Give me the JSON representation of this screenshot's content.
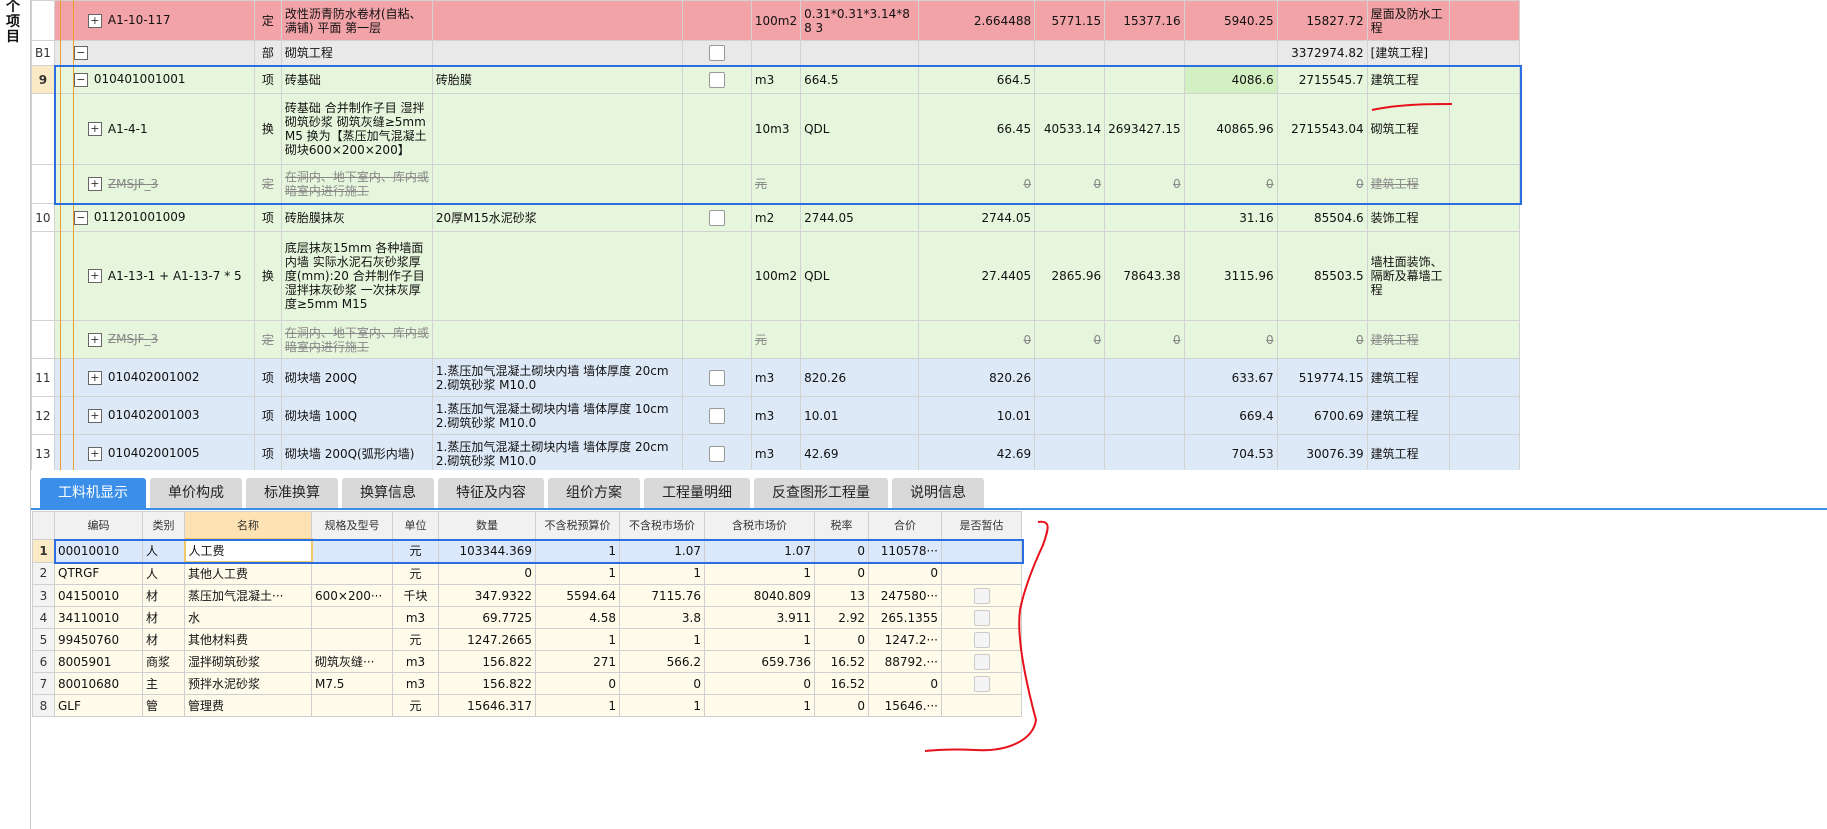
{
  "side_label": [
    "个",
    "项",
    "目"
  ],
  "upper_rows": [
    {
      "style": "red",
      "rowno": "",
      "tree": "+",
      "code": "A1-10-117",
      "type": "定",
      "name": "改性沥青防水卷材(自粘、满铺) 平面 第一层",
      "feature": "",
      "check": false,
      "unit": "100m2",
      "expr": "0.31*0.31*3.14*88 3",
      "qty": "2.664488",
      "c1": "5771.15",
      "c2": "15377.16",
      "price": "5940.25",
      "total": "15827.72",
      "major": "屋面及防水工程"
    },
    {
      "style": "gray",
      "rowno": "B1",
      "tree": "−",
      "code": "",
      "type": "部",
      "name": "砌筑工程",
      "feature": "",
      "check": true,
      "unit": "",
      "expr": "",
      "qty": "",
      "c1": "",
      "c2": "",
      "price": "",
      "total": "3372974.82",
      "major": "[建筑工程]"
    },
    {
      "style": "green",
      "rowno": "9",
      "tree": "−",
      "code": "010401001001",
      "type": "项",
      "name": "砖基础",
      "feature": "砖胎膜",
      "check": true,
      "unit": "m3",
      "expr": "664.5",
      "qty": "664.5",
      "c1": "",
      "c2": "",
      "price": "4086.6",
      "total": "2715545.7",
      "major": "建筑工程"
    },
    {
      "style": "green",
      "rowno": "",
      "tree": "+",
      "code": "A1-4-1",
      "type": "换",
      "name": "砖基础 合并制作子目 湿拌砌筑砂浆 砌筑灰缝≥5mm M5 换为【蒸压加气混凝土砌块600×200×200】",
      "feature": "",
      "check": false,
      "unit": "10m3",
      "expr": "QDL",
      "qty": "66.45",
      "c1": "40533.14",
      "c2": "2693427.15",
      "price": "40865.96",
      "total": "2715543.04",
      "major": "砌筑工程"
    },
    {
      "style": "green strike",
      "rowno": "",
      "tree": "+",
      "code": "ZMSJF_3",
      "type": "定",
      "name": "在洞内、地下室内、库内或暗室内进行施工",
      "feature": "",
      "check": false,
      "unit": "元",
      "expr": "",
      "qty": "0",
      "c1": "0",
      "c2": "0",
      "price": "0",
      "total": "0",
      "major": "建筑工程"
    },
    {
      "style": "green",
      "rowno": "10",
      "tree": "−",
      "code": "011201001009",
      "type": "项",
      "name": "砖胎膜抹灰",
      "feature": "20厚M15水泥砂浆",
      "check": true,
      "unit": "m2",
      "expr": "2744.05",
      "qty": "2744.05",
      "c1": "",
      "c2": "",
      "price": "31.16",
      "total": "85504.6",
      "major": "装饰工程"
    },
    {
      "style": "green",
      "rowno": "",
      "tree": "+",
      "code": "A1-13-1 + A1-13-7 * 5",
      "type": "换",
      "name": "底层抹灰15mm 各种墙面 内墙 实际水泥石灰砂浆厚度(mm):20 合并制作子目 湿拌抹灰砂浆 一次抹灰厚度≥5mm M15",
      "feature": "",
      "check": false,
      "unit": "100m2",
      "expr": "QDL",
      "qty": "27.4405",
      "c1": "2865.96",
      "c2": "78643.38",
      "price": "3115.96",
      "total": "85503.5",
      "major": "墙柱面装饰、隔断及幕墙工程"
    },
    {
      "style": "green strike",
      "rowno": "",
      "tree": "+",
      "code": "ZMSJF_3",
      "type": "定",
      "name": "在洞内、地下室内、库内或暗室内进行施工",
      "feature": "",
      "check": false,
      "unit": "元",
      "expr": "",
      "qty": "0",
      "c1": "0",
      "c2": "0",
      "price": "0",
      "total": "0",
      "major": "建筑工程"
    },
    {
      "style": "blue",
      "rowno": "11",
      "tree": "+",
      "code": "010402001002",
      "type": "项",
      "name": "砌块墙 200Q",
      "feature": "1.蒸压加气混凝土砌块内墙 墙体厚度 20cm 2.砌筑砂浆 M10.0",
      "check": true,
      "unit": "m3",
      "expr": "820.26",
      "qty": "820.26",
      "c1": "",
      "c2": "",
      "price": "633.67",
      "total": "519774.15",
      "major": "建筑工程"
    },
    {
      "style": "blue",
      "rowno": "12",
      "tree": "+",
      "code": "010402001003",
      "type": "项",
      "name": "砌块墙 100Q",
      "feature": "1.蒸压加气混凝土砌块内墙 墙体厚度 10cm 2.砌筑砂浆 M10.0",
      "check": true,
      "unit": "m3",
      "expr": "10.01",
      "qty": "10.01",
      "c1": "",
      "c2": "",
      "price": "669.4",
      "total": "6700.69",
      "major": "建筑工程"
    },
    {
      "style": "blue",
      "rowno": "13",
      "tree": "+",
      "code": "010402001005",
      "type": "项",
      "name": "砌块墙 200Q(弧形内墙)",
      "feature": "1.蒸压加气混凝土砌块内墙 墙体厚度 20cm 2.砌筑砂浆 M10.0",
      "check": true,
      "unit": "m3",
      "expr": "42.69",
      "qty": "42.69",
      "c1": "",
      "c2": "",
      "price": "704.53",
      "total": "30076.39",
      "major": "建筑工程"
    }
  ],
  "tabs": [
    "工料机显示",
    "单价构成",
    "标准换算",
    "换算信息",
    "特征及内容",
    "组价方案",
    "工程量明细",
    "反查图形工程量",
    "说明信息"
  ],
  "lower_headers": [
    "编码",
    "类别",
    "名称",
    "规格及型号",
    "单位",
    "数量",
    "不含税预算价",
    "不含税市场价",
    "含税市场价",
    "税率",
    "合价",
    "是否暂估"
  ],
  "lower_rows": [
    {
      "no": "1",
      "code": "00010010",
      "cat": "人",
      "name": "人工费",
      "spec": "",
      "unit": "元",
      "qty": "103344.369",
      "p1": "1",
      "p2": "1.07",
      "p3": "1.07",
      "tax": "0",
      "total": "110578···",
      "chk": false
    },
    {
      "no": "2",
      "code": "QTRGF",
      "cat": "人",
      "name": "其他人工费",
      "spec": "",
      "unit": "元",
      "qty": "0",
      "p1": "1",
      "p2": "1",
      "p3": "1",
      "tax": "0",
      "total": "0",
      "chk": false
    },
    {
      "no": "3",
      "code": "04150010",
      "cat": "材",
      "name": "蒸压加气混凝土···",
      "spec": "600×200···",
      "unit": "千块",
      "qty": "347.9322",
      "p1": "5594.64",
      "p2": "7115.76",
      "p3": "8040.809",
      "tax": "13",
      "total": "247580···",
      "chk": true
    },
    {
      "no": "4",
      "code": "34110010",
      "cat": "材",
      "name": "水",
      "spec": "",
      "unit": "m3",
      "qty": "69.7725",
      "p1": "4.58",
      "p2": "3.8",
      "p3": "3.911",
      "tax": "2.92",
      "total": "265.1355",
      "chk": true
    },
    {
      "no": "5",
      "code": "99450760",
      "cat": "材",
      "name": "其他材料费",
      "spec": "",
      "unit": "元",
      "qty": "1247.2665",
      "p1": "1",
      "p2": "1",
      "p3": "1",
      "tax": "0",
      "total": "1247.2···",
      "chk": true
    },
    {
      "no": "6",
      "code": "8005901",
      "cat": "商浆",
      "name": "湿拌砌筑砂浆",
      "spec": "砌筑灰缝···",
      "unit": "m3",
      "qty": "156.822",
      "p1": "271",
      "p2": "566.2",
      "p3": "659.736",
      "tax": "16.52",
      "total": "88792.···",
      "chk": true
    },
    {
      "no": "7",
      "code": "80010680",
      "cat": "主",
      "name": "预拌水泥砂浆",
      "spec": "M7.5",
      "unit": "m3",
      "qty": "156.822",
      "p1": "0",
      "p2": "0",
      "p3": "0",
      "tax": "16.52",
      "total": "0",
      "chk": true
    },
    {
      "no": "8",
      "code": "GLF",
      "cat": "管",
      "name": "管理费",
      "spec": "",
      "unit": "元",
      "qty": "15646.317",
      "p1": "1",
      "p2": "1",
      "p3": "1",
      "tax": "0",
      "total": "15646.···",
      "chk": false
    }
  ],
  "colors": {
    "red_row": "#f2a3a8",
    "green_row": "#e6f6dc",
    "blue_row": "#dde9f7",
    "tab_active": "#3b8fe8",
    "selection": "#2a6ee0",
    "annotation": "#e8101a"
  }
}
